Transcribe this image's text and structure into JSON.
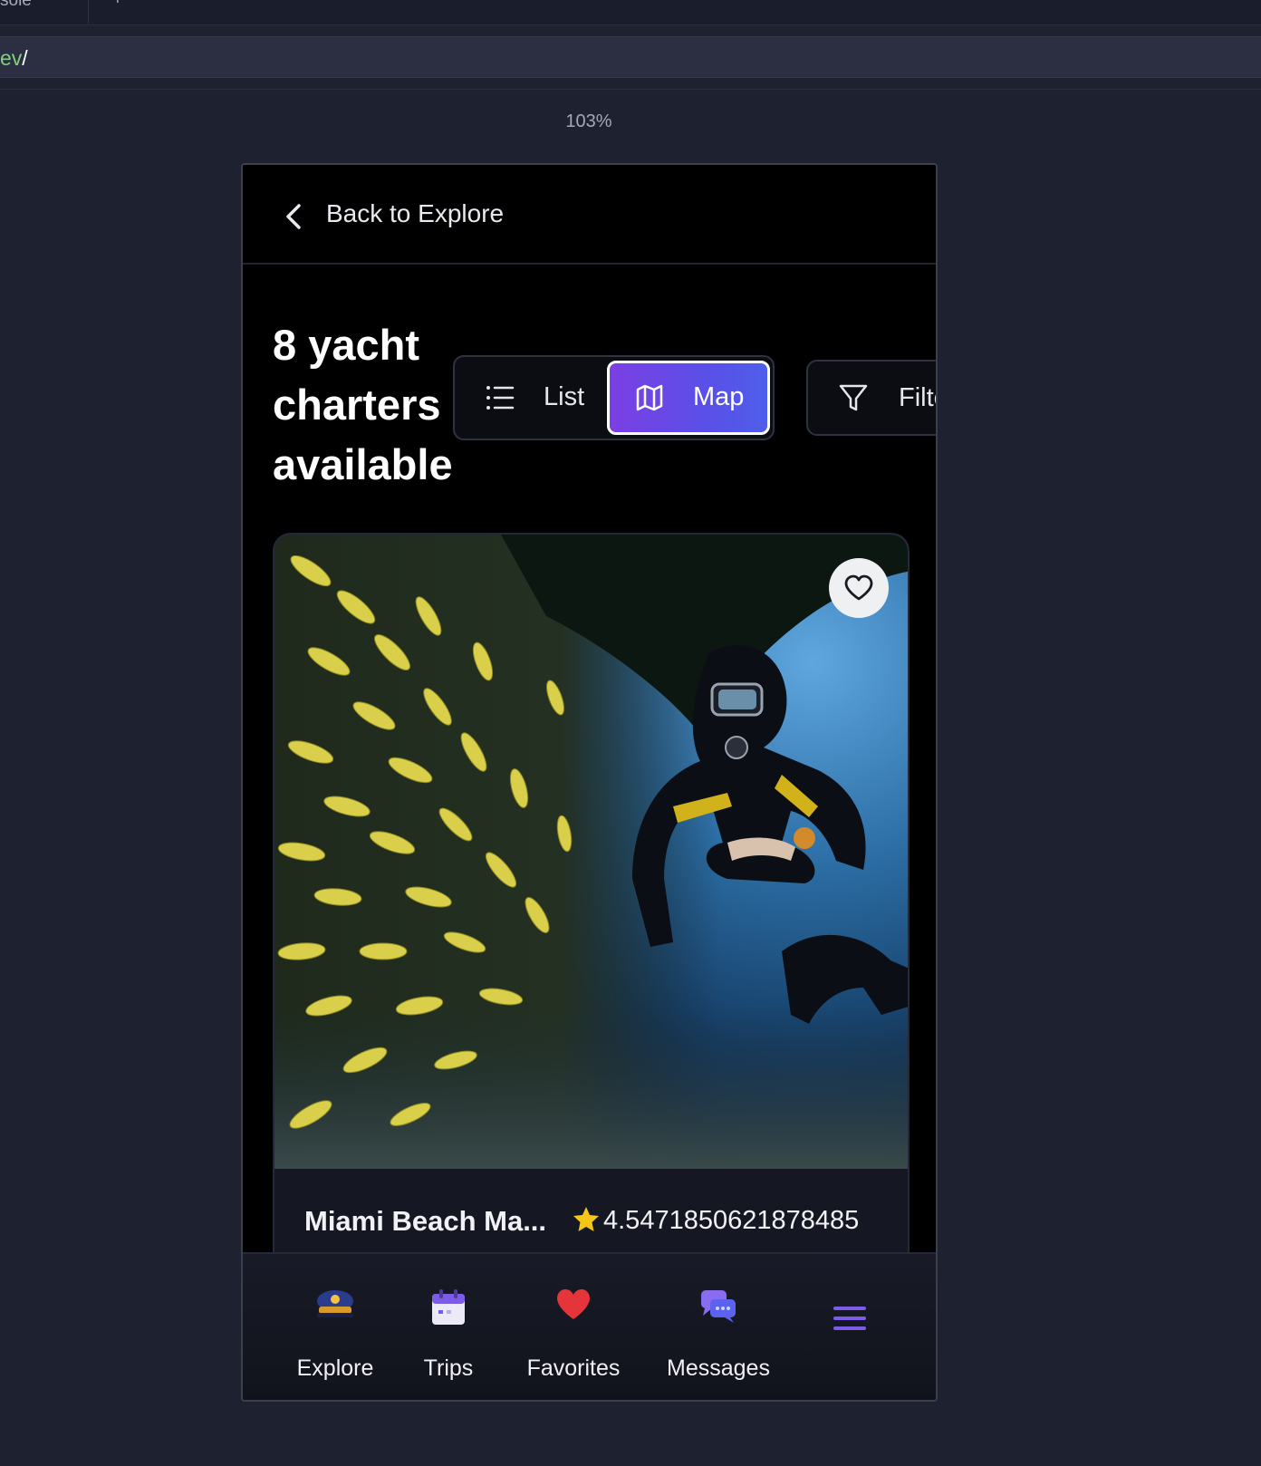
{
  "devtools": {
    "tab_label": "sole",
    "new_tab_symbol": "+",
    "url_green": "ev",
    "url_slash": "/",
    "zoom": "103%"
  },
  "topbar": {
    "back_label": "Back to Explore"
  },
  "results": {
    "title_line1": "8 yacht",
    "title_line2": "charters",
    "title_line3": "available"
  },
  "view_toggle": {
    "list_label": "List",
    "map_label": "Map",
    "active": "Map"
  },
  "filters": {
    "label": "Filters"
  },
  "listing": {
    "name": "Miami Beach Ma...",
    "rating": "4.5471850621878485",
    "favorited": false,
    "image_alt": "scuba diver underwater beside school of yellow fish"
  },
  "bottom_nav": {
    "items": [
      {
        "label": "Explore",
        "icon": "captain-hat-icon"
      },
      {
        "label": "Trips",
        "icon": "calendar-icon"
      },
      {
        "label": "Favorites",
        "icon": "heart-icon"
      },
      {
        "label": "Messages",
        "icon": "chat-bubbles-icon"
      },
      {
        "label": "",
        "icon": "hamburger-menu-icon"
      }
    ]
  },
  "colors": {
    "accent_start": "#7b3fe4",
    "accent_end": "#4f5eea",
    "star": "#f5c518",
    "heart": "#e5343a"
  }
}
